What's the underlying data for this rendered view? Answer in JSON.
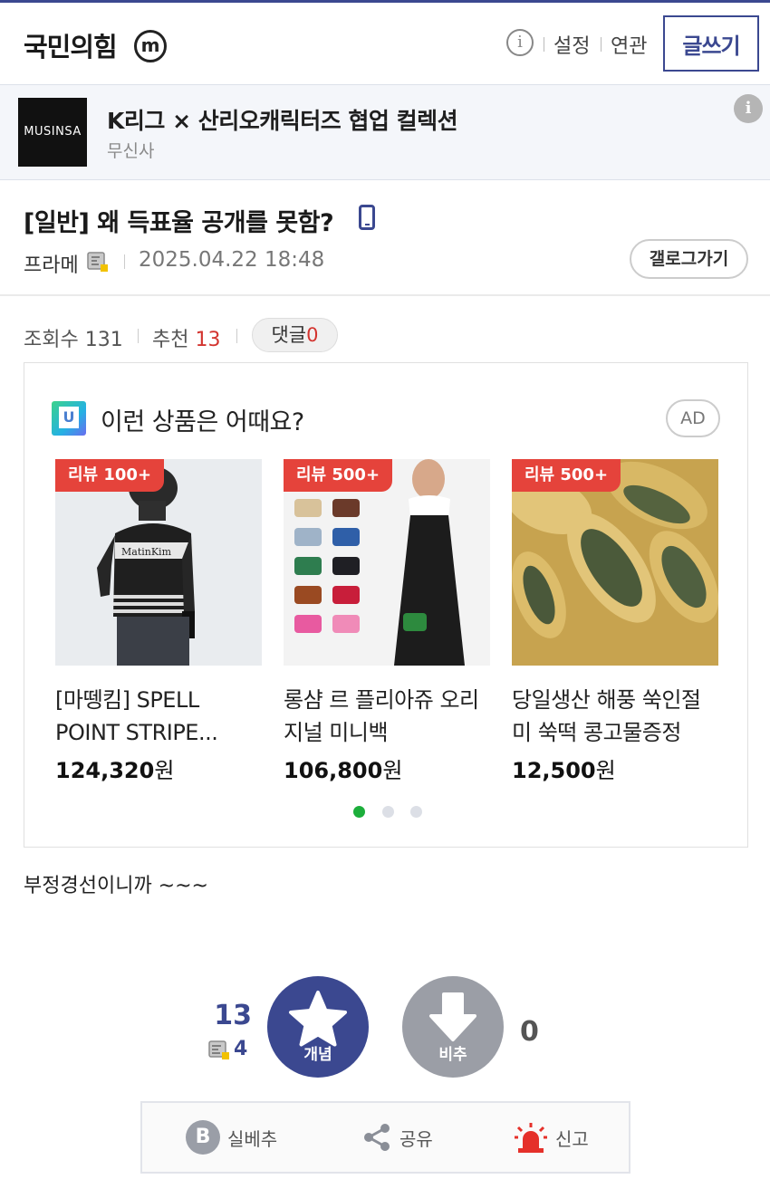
{
  "header": {
    "gallery_title": "국민의힘",
    "minor_badge": "m",
    "info_icon": "info-icon",
    "links": [
      "설정",
      "연관"
    ],
    "write_button": "글쓰기"
  },
  "banner": {
    "logo_text": "MUSINSA",
    "title": "K리그 × 산리오캐릭터즈 협업 컬렉션",
    "subtitle": "무신사",
    "info_icon": "i"
  },
  "post": {
    "title": "[일반] 왜 득표율 공개를 못함?",
    "author": "프라메",
    "date": "2025.04.22 18:48",
    "gallery_button": "갤로그가기"
  },
  "stats": {
    "views_label": "조회수",
    "views": "131",
    "recommend_label": "추천",
    "recommend": "13",
    "comments_label": "댓글",
    "comments": "0"
  },
  "ad": {
    "heading": "이런 상품은 어때요?",
    "tag": "AD",
    "products": [
      {
        "badge": "리뷰 100+",
        "name": "[마뗑킴] SPELL POINT STRIPE...",
        "price": "124,320",
        "currency": "원"
      },
      {
        "badge": "리뷰 500+",
        "name": "롱샴 르 플리아쥬 오리지널 미니백",
        "price": "106,800",
        "currency": "원"
      },
      {
        "badge": "리뷰 500+",
        "name": "당일생산 해풍 쑥인절미 쑥떡 콩고물증정",
        "price": "12,500",
        "currency": "원"
      }
    ],
    "pager": {
      "pages": 3,
      "current": 1
    }
  },
  "content": {
    "body": "부정경선이니까 ~~~"
  },
  "vote": {
    "up_count": "13",
    "fixed_up_count": "4",
    "up_label": "개념",
    "down_label": "비추",
    "down_count": "0"
  },
  "actions": {
    "best": "실베추",
    "share": "공유",
    "report": "신고"
  },
  "colors": {
    "brand": "#3b4890",
    "accent_red": "#d3342f",
    "badge_red": "#e5433b",
    "pager_active": "#1cae3b"
  }
}
